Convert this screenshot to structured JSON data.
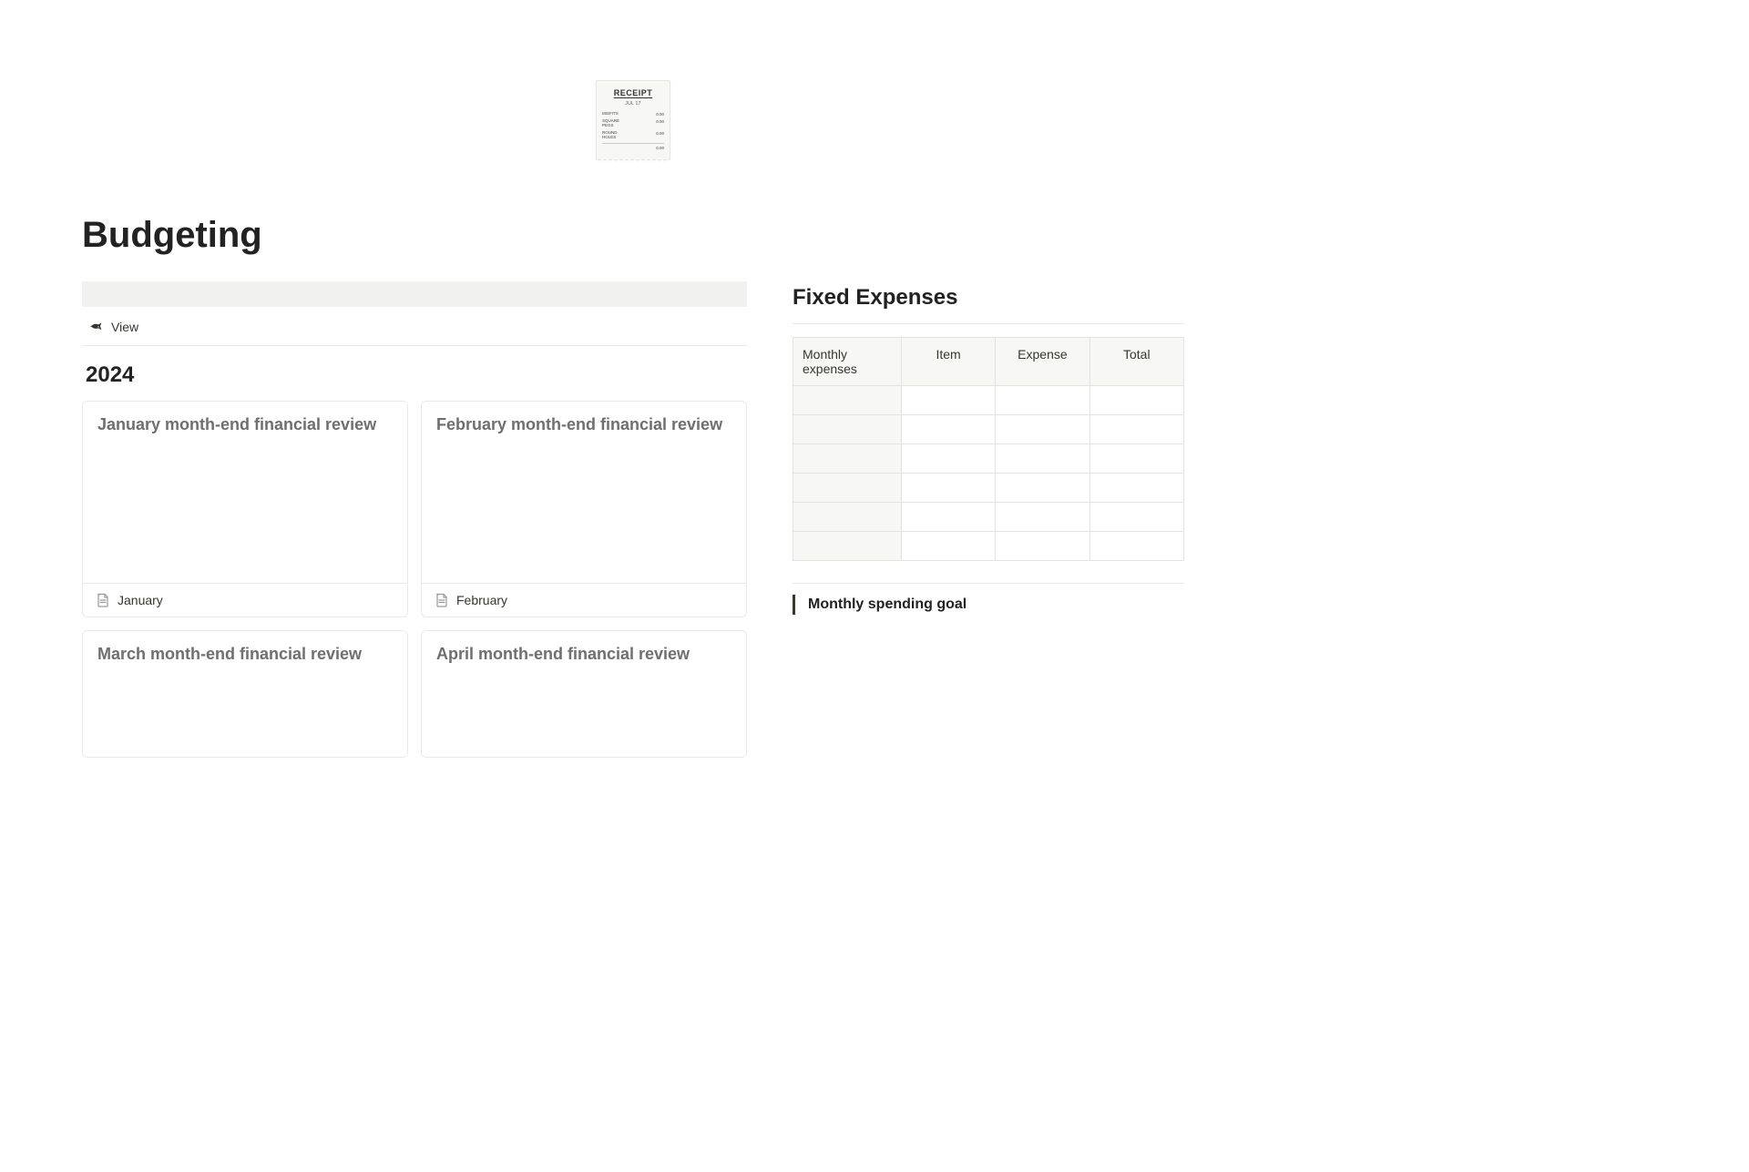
{
  "receipt_icon": {
    "title": "RECEIPT",
    "date": "JUL 17",
    "lines": [
      {
        "label": "MISFITS",
        "value": "0.00"
      },
      {
        "label": "SQUARE\nPEGS",
        "value": "0.00"
      },
      {
        "label": "ROUND\nHOLES",
        "value": "0.00"
      }
    ],
    "total": "0.00"
  },
  "page_title": "Budgeting",
  "view_tab": {
    "label": "View"
  },
  "year_heading": "2024",
  "cards": [
    {
      "title": "January month-end financial review",
      "footer": "January",
      "tall": true
    },
    {
      "title": "February month-end financial review",
      "footer": "February",
      "tall": true
    },
    {
      "title": "March month-end financial review",
      "footer": "",
      "tall": false
    },
    {
      "title": "April month-end financial review",
      "footer": "",
      "tall": false
    }
  ],
  "fixed_expenses": {
    "heading": "Fixed Expenses",
    "columns": [
      "Monthly expenses",
      "Item",
      "Expense",
      "Total"
    ],
    "row_count": 6
  },
  "spending_goal": {
    "label": "Monthly spending goal"
  }
}
